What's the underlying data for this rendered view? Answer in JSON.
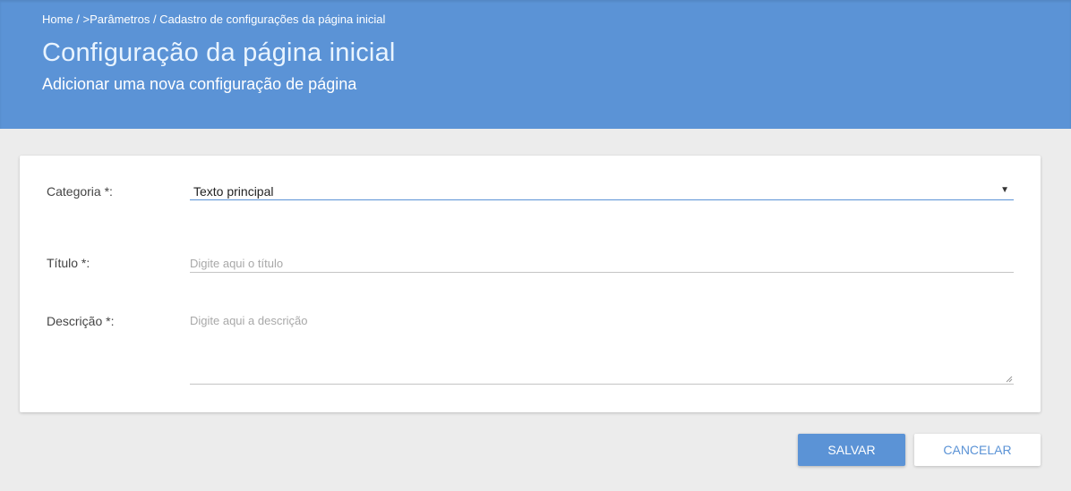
{
  "breadcrumb": {
    "items": [
      "Home",
      ">Parâmetros",
      "Cadastro de configurações da página inicial"
    ],
    "separator": " / "
  },
  "header": {
    "title": "Configuração da página inicial",
    "subtitle": "Adicionar uma nova configuração de página"
  },
  "form": {
    "category_label": "Categoria *:",
    "category_value": "Texto principal",
    "title_label": "Título *:",
    "title_placeholder": "Digite aqui o título",
    "description_label": "Descrição *:",
    "description_placeholder": "Digite aqui a descrição"
  },
  "actions": {
    "save_label": "SALVAR",
    "cancel_label": "CANCELAR"
  },
  "colors": {
    "primary": "#5b93d6",
    "background": "#ececec"
  }
}
